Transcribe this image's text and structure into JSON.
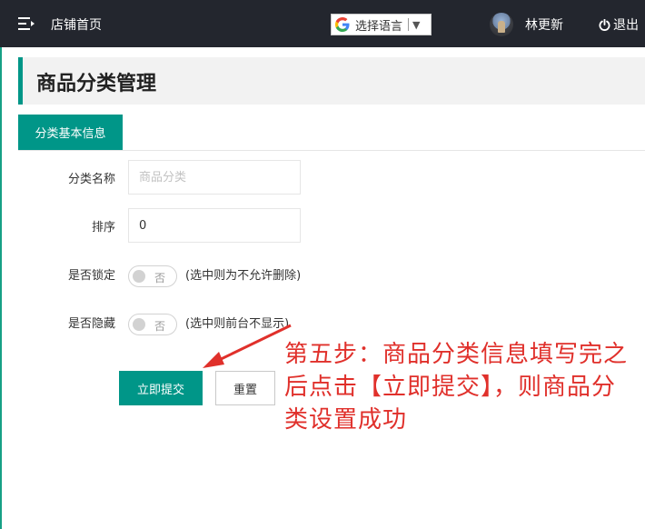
{
  "topbar": {
    "shop_home": "店铺首页",
    "language_label": "选择语言",
    "language_caret": "▼",
    "username": "林更新",
    "logout": "退出"
  },
  "page": {
    "title": "商品分类管理",
    "tab_label": "分类基本信息"
  },
  "form": {
    "category_name_label": "分类名称",
    "category_name_placeholder": "商品分类",
    "category_name_value": "",
    "sort_label": "排序",
    "sort_value": "0",
    "lock_label": "是否锁定",
    "lock_switch_text": "否",
    "lock_hint": "(选中则为不允许删除)",
    "hidden_label": "是否隐藏",
    "hidden_switch_text": "否",
    "hidden_hint": "(选中则前台不显示)",
    "submit_label": "立即提交",
    "reset_label": "重置"
  },
  "annotation": {
    "text": "第五步：商品分类信息填写完之后点击【立即提交】，则商品分类设置成功"
  },
  "colors": {
    "topbar_bg": "#23262e",
    "accent": "#009688",
    "annotation": "#e0302b"
  },
  "icons": {
    "menu": "menu-icon",
    "google": "google-icon",
    "power": "power-icon"
  }
}
